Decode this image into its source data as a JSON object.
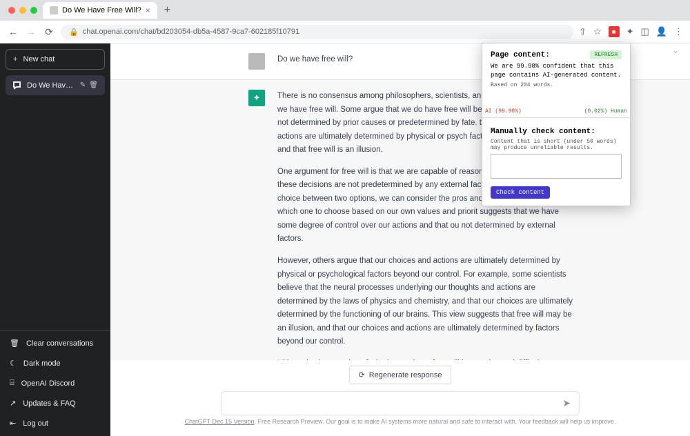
{
  "browser": {
    "tab_title": "Do We Have Free Will?",
    "url": "chat.openai.com/chat/bd203054-db5a-4587-9ca7-602185f10791"
  },
  "sidebar": {
    "new_chat": "New chat",
    "conversation": "Do We Have Free Wil",
    "bottom": {
      "clear": "Clear conversations",
      "dark": "Dark mode",
      "discord": "OpenAI Discord",
      "updates": "Updates & FAQ",
      "logout": "Log out"
    }
  },
  "chat": {
    "user_msg": "Do we have free will?",
    "p1": "There is no consensus among philosophers, scientists, and theologians on whether we have free will. Some argue that we do have free will because we choices that are not determined by prior causes or predetermined by fate. that our choices and actions are ultimately determined by physical or psych factors beyond our control, and that free will is an illusion.",
    "p2": "One argument for free will is that we are capable of reasoning and making c that these decisions are not predetermined by any external factors. For exa faced with a choice between two options, we can consider the pros and con option and decide which one to choose based on our own values and priorit suggests that we have some degree of control over our actions and that ou not determined by external factors.",
    "p3": "However, others argue that our choices and actions are ultimately determined by physical or psychological factors beyond our control. For example, some scientists believe that the neural processes underlying our thoughts and actions are determined by the laws of physics and chemistry, and that our choices are ultimately determined by the functioning of our brains. This view suggests that free will may be an illusion, and that our choices and actions are ultimately determined by factors beyond our control.",
    "p4": "Ultimately, the question of whether we have free will is complex and difficult to answer definitively. It remains a subject of debate among philosophers, scientists, and theologians."
  },
  "input": {
    "regen": "Regenerate response"
  },
  "footer": {
    "link": "ChatGPT Dec 15 Version",
    "text": ". Free Research Preview. Our goal is to make AI systems more natural and safe to interact with. Your feedback will help us improve."
  },
  "popup": {
    "title1": "Page content:",
    "refresh": "REFRESH",
    "confidence": "We are 99.98% confident that this page contains AI-generated content.",
    "based": "Based on 204 words.",
    "ai_label": "AI (99.98%)",
    "human_label": "(0.02%) Human",
    "title2": "Manually check content:",
    "hint": "Content that is short (under 50 words) may produce unreliable results.",
    "check_btn": "Check content"
  }
}
